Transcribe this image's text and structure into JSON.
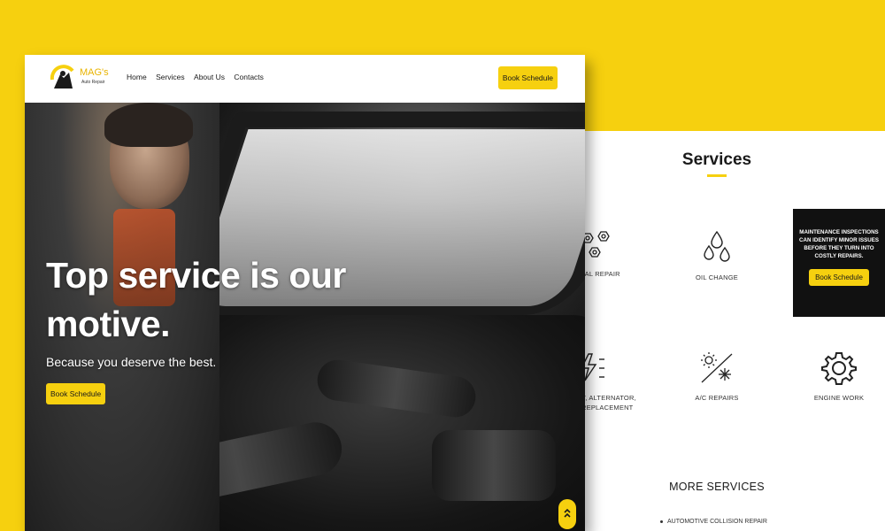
{
  "colors": {
    "accent": "#f6d00f",
    "dark": "#111111",
    "text": "#1a1a1a"
  },
  "home": {
    "logo": {
      "name": "MAG's",
      "subtitle": "Auto Repair",
      "icon": "mechanic-logo-icon"
    },
    "nav": [
      "Home",
      "Services",
      "About Us",
      "Contacts"
    ],
    "nav_button": "Book Schedule",
    "hero": {
      "title_line1": "Top service is our",
      "title_line2": "motive.",
      "subtitle": "Because you deserve the best.",
      "button": "Book Schedule",
      "scroll_icon": "double-chevron-up-icon"
    }
  },
  "services_page": {
    "title": "Services",
    "items": [
      {
        "label": "RAL REPAIR",
        "icon": "hexagon-cluster-icon"
      },
      {
        "label": "OIL CHANGE",
        "icon": "oil-drops-icon"
      },
      {
        "label_line1": "Y, ALTERNATOR,",
        "label_line2": "REPLACEMENT",
        "icon": "lightning-icon"
      },
      {
        "label": "A/C REPAIRS",
        "icon": "sun-snowflake-icon"
      },
      {
        "label": "ENGINE WORK",
        "icon": "gear-icon"
      }
    ],
    "promo": {
      "text": "MAINTENANCE INSPECTIONS CAN IDENTIFY MINOR ISSUES BEFORE THEY TURN INTO COSTLY REPAIRS.",
      "button": "Book Schedule"
    },
    "more_title": "MORE SERVICES",
    "more_items": [
      "AUTOMOTIVE COLLISION REPAIR"
    ]
  }
}
